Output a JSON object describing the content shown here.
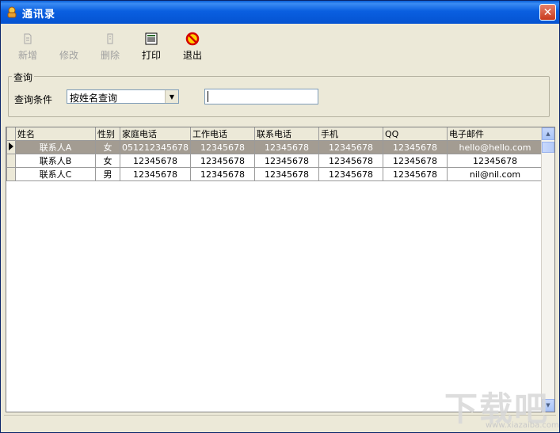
{
  "window": {
    "title": "通讯录",
    "close_glyph": "✕"
  },
  "toolbar": [
    {
      "label": "新增",
      "icon": "new-doc-icon",
      "enabled": false
    },
    {
      "label": "修改",
      "icon": "edit-icon",
      "enabled": false
    },
    {
      "label": "删除",
      "icon": "delete-icon",
      "enabled": false
    },
    {
      "label": "打印",
      "icon": "print-icon",
      "enabled": true
    },
    {
      "label": "退出",
      "icon": "exit-icon",
      "enabled": true
    }
  ],
  "query": {
    "group_title": "查询",
    "condition_label": "查询条件",
    "condition_value": "按姓名查询",
    "search_value": ""
  },
  "grid": {
    "columns": [
      "姓名",
      "性别",
      "家庭电话",
      "工作电话",
      "联系电话",
      "手机",
      "QQ",
      "电子邮件"
    ],
    "rows": [
      [
        "联系人A",
        "女",
        "051212345678",
        "12345678",
        "12345678",
        "12345678",
        "12345678",
        "hello@hello.com"
      ],
      [
        "联系人B",
        "女",
        "12345678",
        "12345678",
        "12345678",
        "12345678",
        "12345678",
        "12345678"
      ],
      [
        "联系人C",
        "男",
        "12345678",
        "12345678",
        "12345678",
        "12345678",
        "12345678",
        "nil@nil.com"
      ]
    ],
    "selected_row": 0
  },
  "watermark": {
    "main": "下载吧",
    "sub": "www.xiazaiba.com"
  }
}
